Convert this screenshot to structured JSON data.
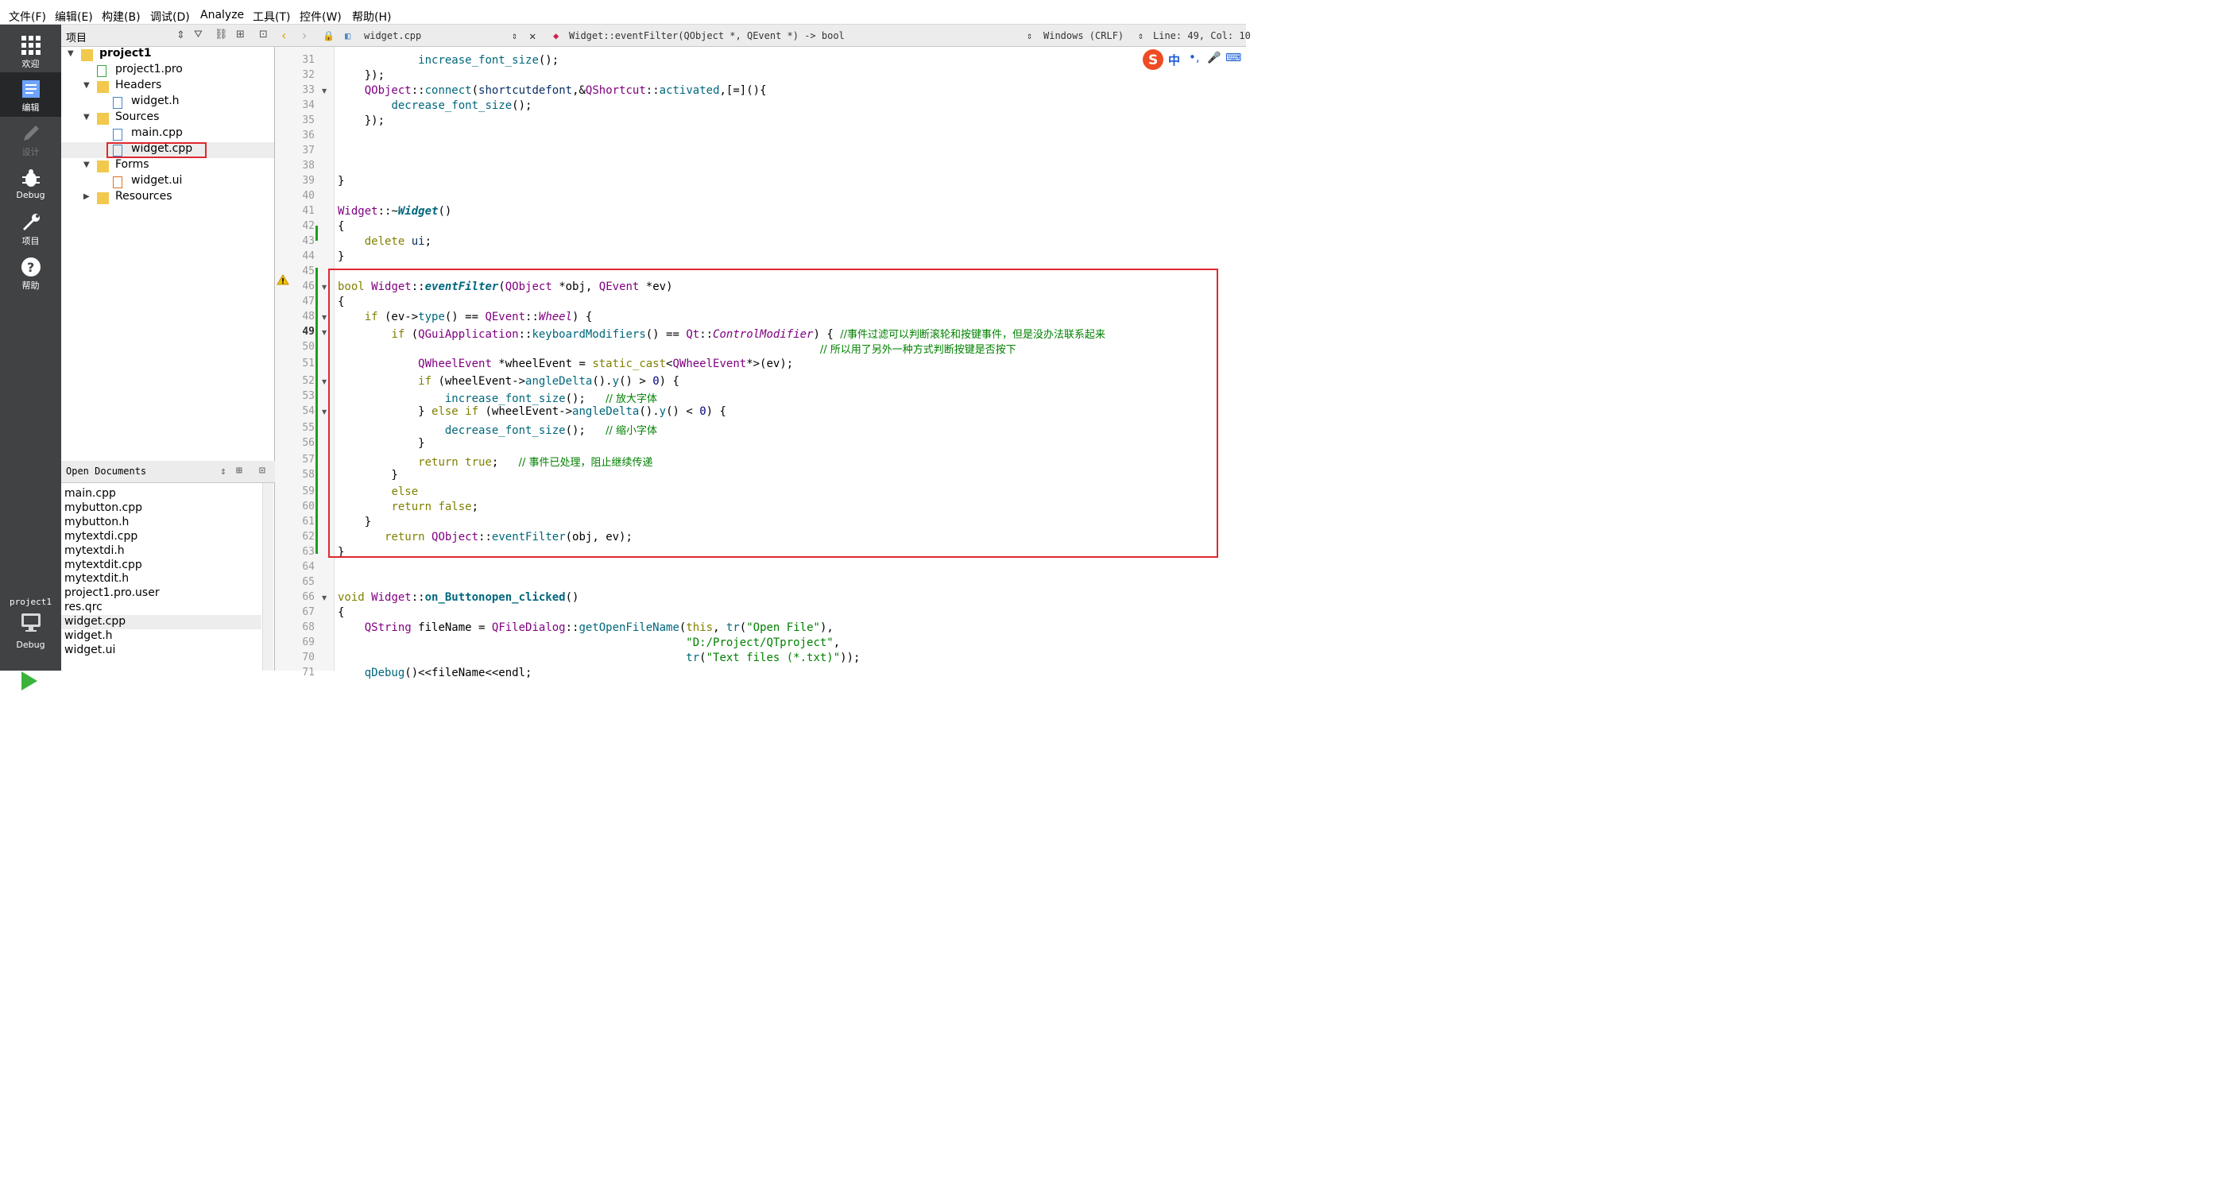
{
  "menu": [
    "文件(F)",
    "编辑(E)",
    "构建(B)",
    "调试(D)",
    "Analyze",
    "工具(T)",
    "控件(W)",
    "帮助(H)"
  ],
  "modes": [
    {
      "label": "欢迎",
      "icon": "grid-icon"
    },
    {
      "label": "编辑",
      "icon": "edit-doc-icon"
    },
    {
      "label": "设计",
      "icon": "pencil-icon"
    },
    {
      "label": "Debug",
      "icon": "bug-icon"
    },
    {
      "label": "项目",
      "icon": "wrench-icon"
    },
    {
      "label": "帮助",
      "icon": "help-icon"
    }
  ],
  "target": {
    "project": "project1",
    "config": "Debug"
  },
  "project_pane": {
    "title": "项目"
  },
  "tree": [
    {
      "label": "project1",
      "bold": true,
      "arrow": "▼",
      "icon": "folder-qt-icon"
    },
    {
      "label": "project1.pro",
      "arrow": "",
      "icon": "pro-file-icon"
    },
    {
      "label": "Headers",
      "arrow": "▼",
      "icon": "folder-h-icon"
    },
    {
      "label": "widget.h",
      "arrow": "",
      "icon": "header-file-icon"
    },
    {
      "label": "Sources",
      "arrow": "▼",
      "icon": "folder-cpp-icon"
    },
    {
      "label": "main.cpp",
      "arrow": "",
      "icon": "cpp-file-icon"
    },
    {
      "label": "widget.cpp",
      "arrow": "",
      "icon": "cpp-file-icon"
    },
    {
      "label": "Forms",
      "arrow": "▼",
      "icon": "folder-forms-icon"
    },
    {
      "label": "widget.ui",
      "arrow": "",
      "icon": "ui-file-icon"
    },
    {
      "label": "Resources",
      "arrow": "▶",
      "icon": "folder-res-icon"
    }
  ],
  "open_documents": {
    "title": "Open Documents",
    "items": [
      "main.cpp",
      "mybutton.cpp",
      "mybutton.h",
      "mytextdi.cpp",
      "mytextdi.h",
      "mytextdit.cpp",
      "mytextdit.h",
      "project1.pro.user",
      "res.qrc",
      "widget.cpp",
      "widget.h",
      "widget.ui"
    ]
  },
  "editor": {
    "file": "widget.cpp",
    "symbol": "Widget::eventFilter(QObject *, QEvent *) -> bool",
    "line_ending": "Windows (CRLF)",
    "position": "Line: 49, Col: 10"
  },
  "code_lines": [
    {
      "n": "31",
      "html": "            <span class='fn'>increase_font_size</span>();"
    },
    {
      "n": "32",
      "html": "    });"
    },
    {
      "n": "33",
      "html": "    <span class='ty'>QObject</span>::<span class='fn'>connect</span>(<span class='vr'>shortcutdefont</span>,&amp;<span class='ty'>QShortcut</span>::<span class='fn'>activated</span>,[=](){"
    },
    {
      "n": "34",
      "html": "        <span class='fn'>decrease_font_size</span>();"
    },
    {
      "n": "35",
      "html": "    });"
    },
    {
      "n": "36",
      "html": ""
    },
    {
      "n": "37",
      "html": ""
    },
    {
      "n": "38",
      "html": ""
    },
    {
      "n": "39",
      "html": "}"
    },
    {
      "n": "40",
      "html": ""
    },
    {
      "n": "41",
      "html": "<span class='ty'>Widget</span>::~<span class='it'>Widget</span>()"
    },
    {
      "n": "42",
      "html": "{"
    },
    {
      "n": "43",
      "html": "    <span class='kw'>delete</span> <span class='vr'>ui</span>;"
    },
    {
      "n": "44",
      "html": "}"
    },
    {
      "n": "45",
      "html": ""
    },
    {
      "n": "46",
      "html": "<span class='kw'>bool</span> <span class='ty'>Widget</span>::<span class='it'>eventFilter</span>(<span class='ty'>QObject</span> *obj, <span class='ty'>QEvent</span> *ev)"
    },
    {
      "n": "47",
      "html": "{"
    },
    {
      "n": "48",
      "html": "    <span class='kw'>if</span> (ev-&gt;<span class='fn'>type</span>() == <span class='ty'>QEvent</span>::<span class='en'>Wheel</span>) {"
    },
    {
      "n": "49",
      "html": "        <span class='kw'>if</span> (<span class='ty'>QGuiApplication</span>::<span class='fn'>keyboardModifiers</span>() == <span class='ty'>Qt</span>::<span class='en'>ControlModifier</span>) { <span class='cm'>//事件过滤可以判断滚轮和按键事件，但是没办法联系起来</span>"
    },
    {
      "n": "50",
      "html": "                                                                        <span class='cm'>// 所以用了另外一种方式判断按键是否按下</span>"
    },
    {
      "n": "51",
      "html": "            <span class='ty'>QWheelEvent</span> *wheelEvent = <span class='kw'>static_cast</span>&lt;<span class='ty'>QWheelEvent</span>*&gt;(ev);"
    },
    {
      "n": "52",
      "html": "            <span class='kw'>if</span> (wheelEvent-&gt;<span class='fn'>angleDelta</span>().<span class='fn'>y</span>() &gt; <span class='nm'>0</span>) {"
    },
    {
      "n": "53",
      "html": "                <span class='fn'>increase_font_size</span>();   <span class='cm'>// 放大字体</span>"
    },
    {
      "n": "54",
      "html": "            } <span class='kw'>else</span> <span class='kw'>if</span> (wheelEvent-&gt;<span class='fn'>angleDelta</span>().<span class='fn'>y</span>() &lt; <span class='nm'>0</span>) {"
    },
    {
      "n": "55",
      "html": "                <span class='fn'>decrease_font_size</span>();   <span class='cm'>// 缩小字体</span>"
    },
    {
      "n": "56",
      "html": "            }"
    },
    {
      "n": "57",
      "html": "            <span class='kw'>return</span> <span class='kw'>true</span>;   <span class='cm'>// 事件已处理，阻止继续传递</span>"
    },
    {
      "n": "58",
      "html": "        }"
    },
    {
      "n": "59",
      "html": "        <span class='kw'>else</span>"
    },
    {
      "n": "60",
      "html": "        <span class='kw'>return</span> <span class='kw'>false</span>;"
    },
    {
      "n": "61",
      "html": "    }"
    },
    {
      "n": "62",
      "html": "       <span class='kw'>return</span> <span class='ty'>QObject</span>::<span class='fn'>eventFilter</span>(obj, ev);"
    },
    {
      "n": "63",
      "html": "}"
    },
    {
      "n": "64",
      "html": ""
    },
    {
      "n": "65",
      "html": ""
    },
    {
      "n": "66",
      "html": "<span class='kw'>void</span> <span class='ty'>Widget</span>::<span class='fb'>on_Buttonopen_clicked</span>()"
    },
    {
      "n": "67",
      "html": "{"
    },
    {
      "n": "68",
      "html": "    <span class='ty'>QString</span> fileName = <span class='ty'>QFileDialog</span>::<span class='fn'>getOpenFileName</span>(<span class='kw'>this</span>, <span class='fn'>tr</span>(<span class='st'>\"Open File\"</span>),"
    },
    {
      "n": "69",
      "html": "                                                    <span class='st'>\"D:/Project/QTproject\"</span>,"
    },
    {
      "n": "70",
      "html": "                                                    <span class='fn'>tr</span>(<span class='st'>\"Text files (*.txt)\"</span>));"
    },
    {
      "n": "71",
      "html": "    <span class='fn'>qDebug</span>()&lt;&lt;fileName&lt;&lt;endl;"
    }
  ],
  "fold_lines": [
    "33",
    "46",
    "48",
    "49",
    "52",
    "54",
    "66"
  ],
  "colors": {
    "highlight": "#e0282f",
    "sidebar": "#404244",
    "keyword": "#808000",
    "type": "#800080",
    "function": "#00677c",
    "comment": "#008000"
  }
}
